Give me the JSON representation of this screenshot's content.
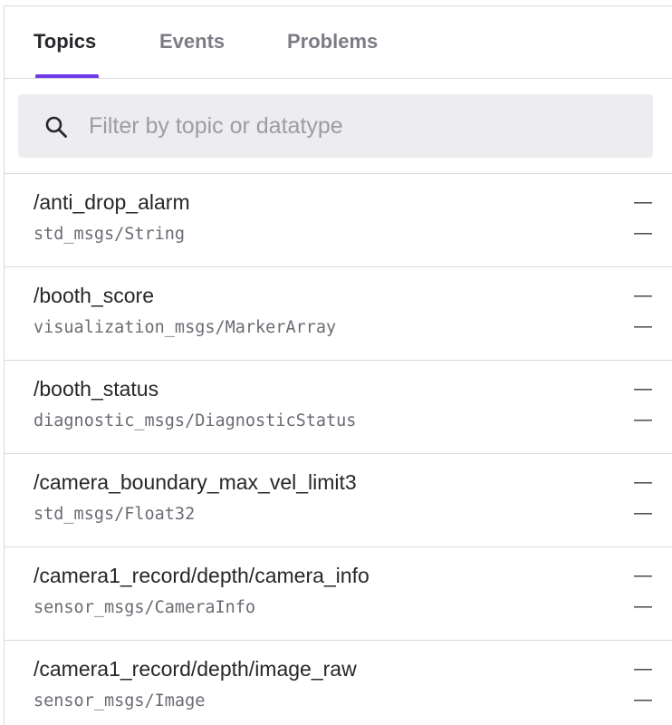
{
  "tabs": [
    {
      "label": "Topics",
      "active": true
    },
    {
      "label": "Events",
      "active": false
    },
    {
      "label": "Problems",
      "active": false
    }
  ],
  "filter": {
    "placeholder": "Filter by topic or datatype",
    "value": "",
    "icon": "search-icon"
  },
  "topics": [
    {
      "name": "/anti_drop_alarm",
      "datatype": "std_msgs/String",
      "stat1": "—",
      "stat2": "—"
    },
    {
      "name": "/booth_score",
      "datatype": "visualization_msgs/MarkerArray",
      "stat1": "—",
      "stat2": "—"
    },
    {
      "name": "/booth_status",
      "datatype": "diagnostic_msgs/DiagnosticStatus",
      "stat1": "—",
      "stat2": "—"
    },
    {
      "name": "/camera_boundary_max_vel_limit3",
      "datatype": "std_msgs/Float32",
      "stat1": "—",
      "stat2": "—"
    },
    {
      "name": "/camera1_record/depth/camera_info",
      "datatype": "sensor_msgs/CameraInfo",
      "stat1": "—",
      "stat2": "—"
    },
    {
      "name": "/camera1_record/depth/image_raw",
      "datatype": "sensor_msgs/Image",
      "stat1": "—",
      "stat2": "—"
    }
  ],
  "colors": {
    "accent": "#6f3be8",
    "text": "#27272b",
    "muted": "#7c7c85",
    "border": "#d9d9de",
    "input_bg": "#ededef"
  }
}
